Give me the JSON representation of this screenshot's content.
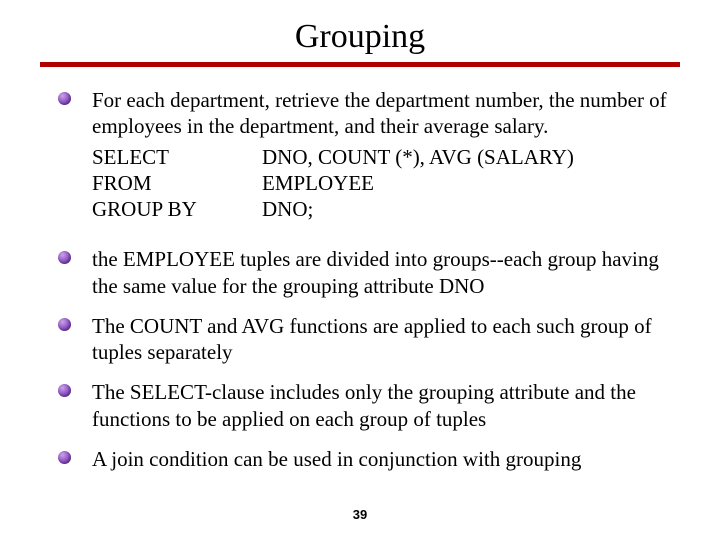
{
  "title": "Grouping",
  "bullets": {
    "b1": {
      "intro": "For each department, retrieve the department number, the number of employees in the department, and their average salary.",
      "sql": {
        "r1k": "SELECT",
        "r1v": "DNO, COUNT (*), AVG (SALARY)",
        "r2k": "FROM",
        "r2v": "EMPLOYEE",
        "r3k": "GROUP BY",
        "r3v": "DNO;"
      }
    },
    "b2": "the EMPLOYEE tuples are divided into groups--each group having the same value for the grouping attribute DNO",
    "b3": "The COUNT and AVG functions are applied to each such group of tuples separately",
    "b4": "The SELECT-clause includes only the grouping attribute and the functions to be applied on each group of tuples",
    "b5": "A join condition can be used in conjunction with grouping"
  },
  "pagenum": "39"
}
